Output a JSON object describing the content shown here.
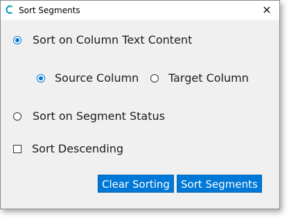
{
  "window": {
    "title": "Sort Segments",
    "close_symbol": "✕",
    "app_icon": "app-logo-icon"
  },
  "options": {
    "sort_text": {
      "label": "Sort on Column Text Content",
      "checked": true
    },
    "source_column": {
      "label": "Source Column",
      "checked": true
    },
    "target_column": {
      "label": "Target Column",
      "checked": false
    },
    "sort_status": {
      "label": "Sort on Segment Status",
      "checked": false
    },
    "sort_descending": {
      "label": "Sort Descending",
      "checked": false
    }
  },
  "buttons": {
    "clear_sorting": "Clear Sorting",
    "sort_segments": "Sort Segments"
  },
  "colors": {
    "accent": "#0078d7",
    "dialog_bg": "#f0f0f0"
  }
}
